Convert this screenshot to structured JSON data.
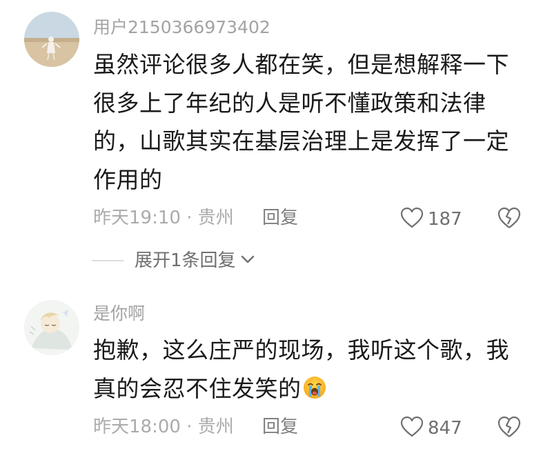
{
  "comments": [
    {
      "username": "用户2150366973402",
      "text": "虽然评论很多人都在笑，但是想解释一下\n很多上了年纪的人是听不懂政策和法律\n的，山歌其实在基层治理上是发挥了一定\n作用的",
      "meta": "昨天19:10 · 贵州",
      "reply_label": "回复",
      "like_count": "187",
      "expand_label": "展开1条回复"
    },
    {
      "username": "是你啊",
      "text": "抱歉，这么庄严的现场，我听这个歌，我\n真的会忍不住发笑的",
      "emoji": "crying-face-emoji",
      "meta": "昨天18:00 · 贵州",
      "reply_label": "回复",
      "like_count": "847"
    }
  ],
  "colors": {
    "text": "#1a1a1a",
    "username": "#a3a3a3",
    "meta": "#ababab",
    "secondary": "#6f6f6f"
  }
}
